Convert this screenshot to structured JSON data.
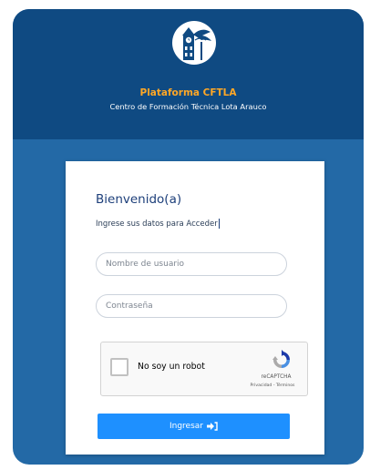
{
  "header": {
    "title": "Plataforma CFTLA",
    "subtitle": "Centro de Formación Técnica Lota Arauco",
    "logo_icon": "clock-tower-tree-logo"
  },
  "form": {
    "heading": "Bienvenido(a)",
    "instructions": "Ingrese sus datos para Acceder",
    "username": {
      "placeholder": "Nombre de usuario",
      "value": ""
    },
    "password": {
      "placeholder": "Contraseña",
      "value": ""
    }
  },
  "captcha": {
    "checkbox_label": "No soy un robot",
    "brand": "reCAPTCHA",
    "links": "Privacidad - Términos",
    "checked": false
  },
  "login_button": {
    "label": "Ingresar",
    "icon": "sign-in-icon"
  },
  "colors": {
    "header_bg": "#0f4a82",
    "body_bg": "#2369a6",
    "title_accent": "#ffa726",
    "button_bg": "#1e90ff",
    "heading_text": "#1d3f7a"
  }
}
